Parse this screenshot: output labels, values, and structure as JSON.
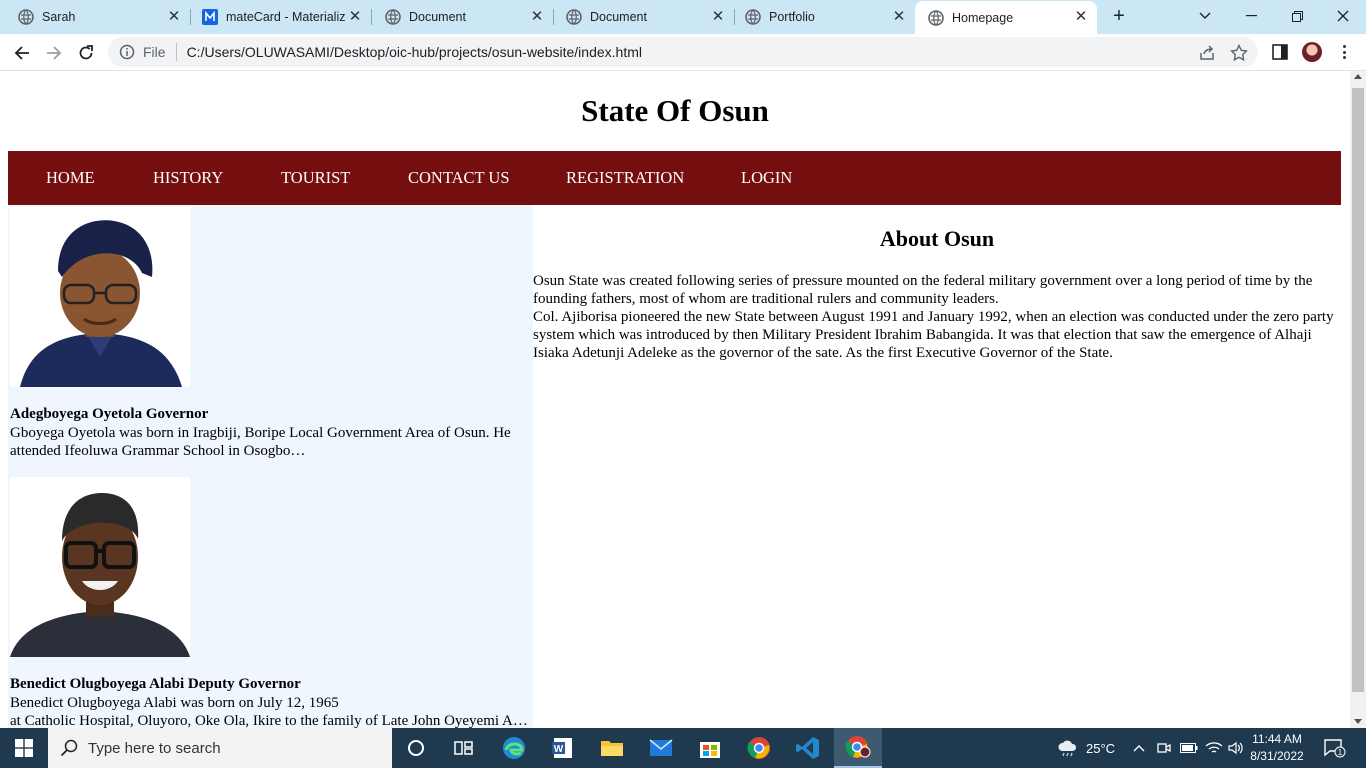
{
  "browser": {
    "tabs": [
      {
        "title": "Sarah",
        "icon": "globe-icon",
        "active": false
      },
      {
        "title": "mateCard - Materialize",
        "icon": "materialize-m-icon",
        "active": false
      },
      {
        "title": "Document",
        "icon": "globe-icon",
        "active": false
      },
      {
        "title": "Document",
        "icon": "globe-icon",
        "active": false
      },
      {
        "title": "Portfolio",
        "icon": "globe-icon",
        "active": false
      },
      {
        "title": "Homepage",
        "icon": "globe-icon",
        "active": true
      }
    ],
    "address": {
      "scheme_label": "File",
      "url": "C:/Users/OLUWASAMI/Desktop/oic-hub/projects/osun-website/index.html"
    }
  },
  "page": {
    "title": "State Of Osun",
    "nav": [
      "HOME",
      "HISTORY",
      "TOURIST",
      "CONTACT US",
      "REGISTRATION",
      "LOGIN"
    ],
    "people": [
      {
        "name": "Adegboyega Oyetola Governor",
        "bio": "Gboyega Oyetola was born in Iragbiji, Boripe Local Government Area of Osun. He attended Ifeoluwa Grammar School in Osogbo…"
      },
      {
        "name": "Benedict Olugboyega Alabi Deputy Governor",
        "bio_line1": "Benedict Olugboyega Alabi was born on July 12, 1965",
        "bio_line2": "at Catholic Hospital, Oluyoro, Oke Ola, Ikire to the family of Late John Oyeyemi Alabi"
      }
    ],
    "about": {
      "heading": "About Osun",
      "paragraph1": "Osun State was created following series of pressure mounted on the federal military government over a long period of time by the founding fathers, most of whom are traditional rulers and community leaders.",
      "paragraph2": "Col. Ajiborisa pioneered the new State between August 1991 and January 1992, when an election was conducted under the zero party system which was introduced by then Military President Ibrahim Babangida. It was that election that saw the emergence of Alhaji Isiaka Adetunji Adeleke as the governor of the sate. As the first Executive Governor of the State."
    },
    "colors": {
      "nav_bg": "#750e0e",
      "sidebar_bg": "#eff6fe"
    }
  },
  "taskbar": {
    "search_placeholder": "Type here to search",
    "apps": [
      "cortana-icon",
      "task-view-icon",
      "edge-icon",
      "word-icon",
      "file-explorer-icon",
      "mail-icon",
      "store-icon",
      "chrome-icon",
      "vscode-icon",
      "chrome-profile-icon"
    ],
    "weather": "25°C",
    "time": "11:44 AM",
    "date": "8/31/2022",
    "notification_count": "1"
  }
}
